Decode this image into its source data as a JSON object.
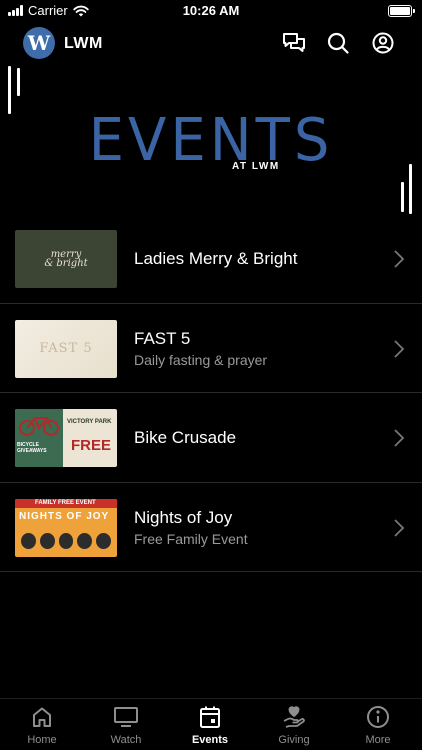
{
  "status_bar": {
    "carrier": "Carrier",
    "time": "10:26 AM"
  },
  "header": {
    "logo_letter": "W",
    "app_name": "LWM"
  },
  "banner": {
    "title": "EVENTS",
    "subtitle": "AT LWM"
  },
  "events": [
    {
      "title": "Ladies Merry & Bright",
      "subtitle": "",
      "thumb_text": [
        "merry",
        "& bright"
      ]
    },
    {
      "title": "FAST 5",
      "subtitle": "Daily fasting & prayer",
      "thumb_text": [
        "FAST 5"
      ]
    },
    {
      "title": "Bike Crusade",
      "subtitle": "",
      "thumb_text": [
        "VICTORY PARK",
        "FREE",
        "BICYCLE GIVEAWAYS"
      ]
    },
    {
      "title": "Nights of Joy",
      "subtitle": "Free Family Event",
      "thumb_text": [
        "FAMILY FREE EVENT",
        "NIGHTS OF JOY"
      ]
    }
  ],
  "tabs": [
    {
      "label": "Home",
      "icon": "home-icon"
    },
    {
      "label": "Watch",
      "icon": "tv-icon"
    },
    {
      "label": "Events",
      "icon": "calendar-icon",
      "active": true
    },
    {
      "label": "Giving",
      "icon": "giving-hand-icon"
    },
    {
      "label": "More",
      "icon": "info-icon"
    }
  ],
  "colors": {
    "accent": "#3b64a5",
    "background": "#000000",
    "inactive": "#8e8e8e"
  }
}
